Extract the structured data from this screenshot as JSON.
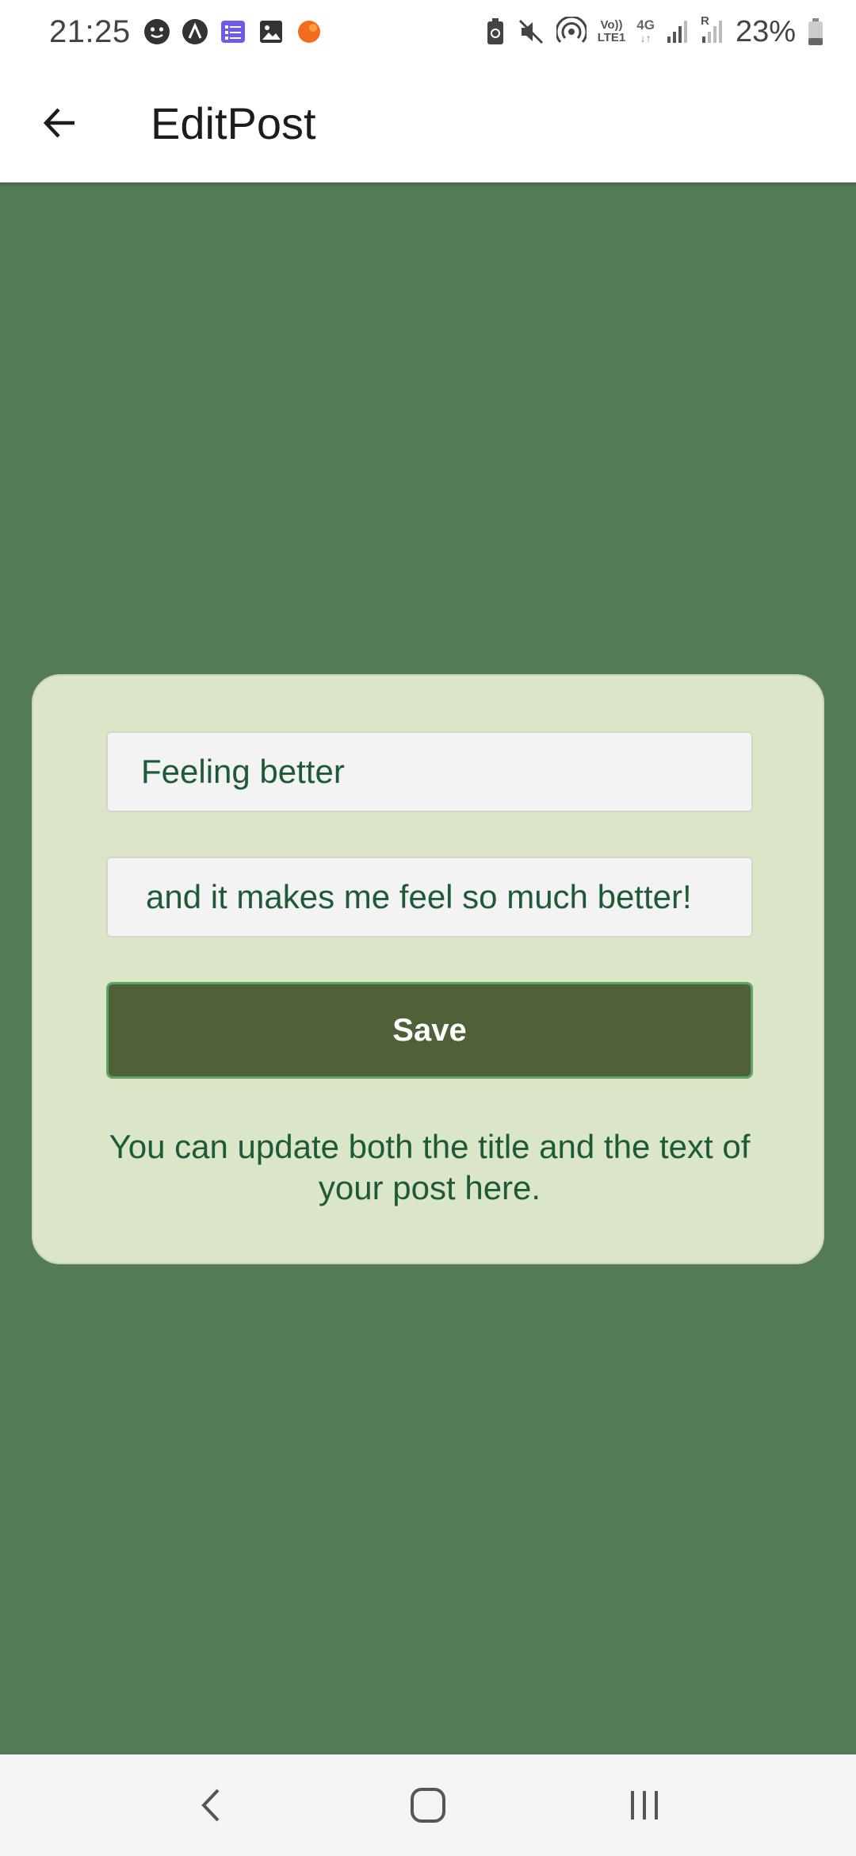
{
  "status_bar": {
    "time": "21:25",
    "notification_icons": [
      "face-icon",
      "lambda-icon",
      "form-icon",
      "image-icon",
      "orange-dot-icon"
    ],
    "right_icons": [
      "battery-saver-icon",
      "mute-icon",
      "hotspot-icon",
      "volte-icon",
      "4g-icon",
      "signal-icon",
      "roaming-signal-icon"
    ],
    "volte_label_top": "Vo))",
    "volte_label_bottom": "LTE1",
    "network_label": "4G",
    "roaming_label": "R",
    "battery_percent": "23%"
  },
  "app_bar": {
    "back_icon": "arrow-left-icon",
    "title": "EditPost"
  },
  "form": {
    "title_value": "Feeling better",
    "body_value": "and it makes me feel so much better!",
    "save_label": "Save",
    "helper_text": "You can update both the title and the text of your post here."
  },
  "nav_bar": {
    "icons": [
      "back-chevron-icon",
      "home-icon",
      "recents-icon"
    ]
  },
  "colors": {
    "background": "#537b55",
    "card": "#dbe6c8",
    "button": "#50613a",
    "button_border": "#5fa56a",
    "text_green": "#1f5a37"
  }
}
